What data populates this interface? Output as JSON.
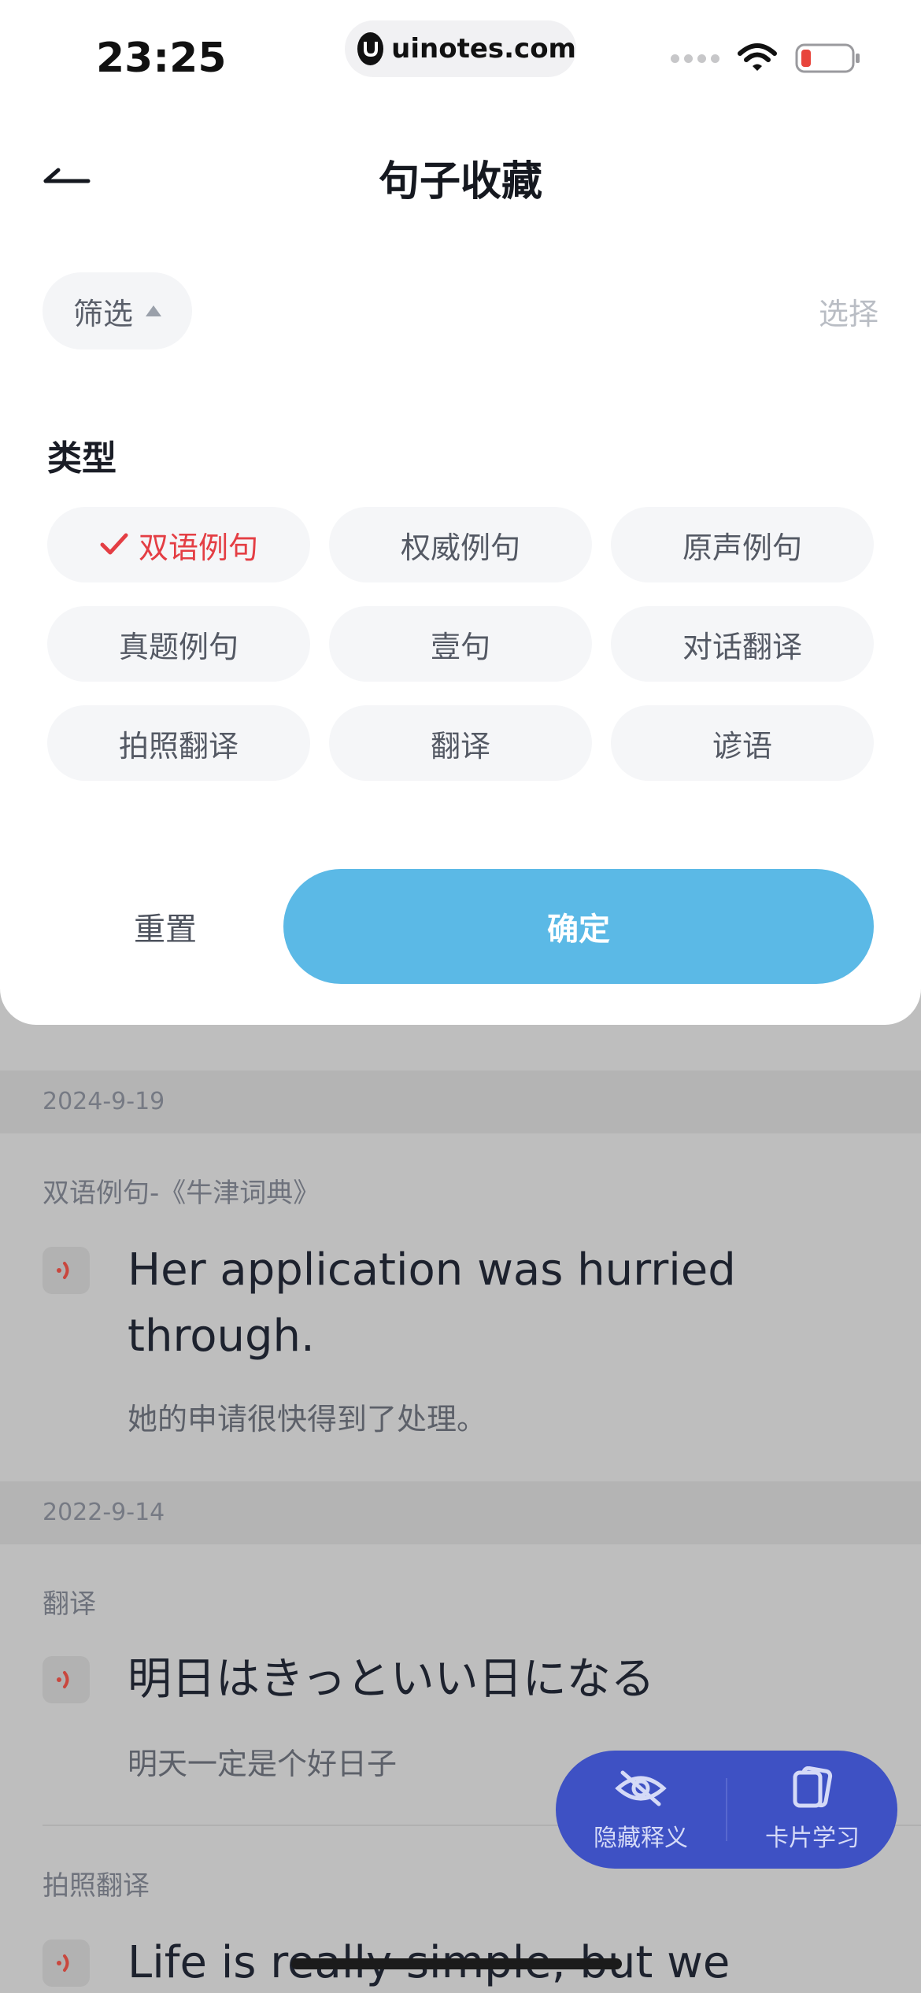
{
  "status_bar": {
    "time": "23:25",
    "url": "uinotes.com",
    "battery_color": "#e8453c"
  },
  "header": {
    "title": "句子收藏",
    "back_icon": "arrow-left-icon"
  },
  "toolbar": {
    "filter_label": "筛选",
    "select_label": "选择"
  },
  "filter_panel": {
    "section_title": "类型",
    "options": [
      {
        "label": "双语例句",
        "selected": true
      },
      {
        "label": "权威例句",
        "selected": false
      },
      {
        "label": "原声例句",
        "selected": false
      },
      {
        "label": "真题例句",
        "selected": false
      },
      {
        "label": "壹句",
        "selected": false
      },
      {
        "label": "对话翻译",
        "selected": false
      },
      {
        "label": "拍照翻译",
        "selected": false
      },
      {
        "label": "翻译",
        "selected": false
      },
      {
        "label": "谚语",
        "selected": false
      }
    ],
    "reset_label": "重置",
    "confirm_label": "确定",
    "accent_color": "#5bb9e6",
    "selected_color": "#e43e44"
  },
  "list": {
    "groups": [
      {
        "date": "2024-9-19",
        "items": [
          {
            "source": "双语例句-《牛津词典》",
            "sentence": "Her application was hurried through.",
            "translation": "她的申请很快得到了处理。"
          }
        ]
      },
      {
        "date": "2022-9-14",
        "items": [
          {
            "source": "翻译",
            "sentence": "明日はきっといい日になる",
            "translation": "明天一定是个好日子"
          },
          {
            "source": "拍照翻译",
            "sentence": "Life is really simple, but we"
          }
        ]
      }
    ]
  },
  "floating_bar": {
    "hide_label": "隐藏释义",
    "card_label": "卡片学习",
    "color": "#3e51c4"
  }
}
